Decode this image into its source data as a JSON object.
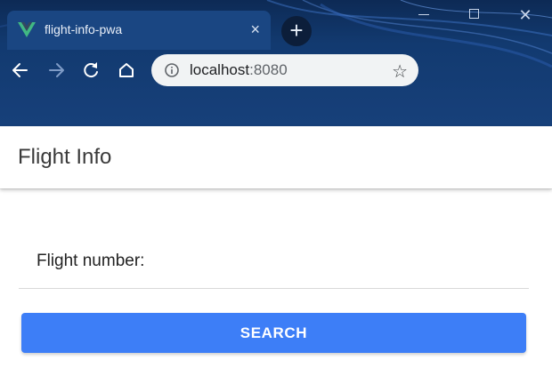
{
  "browser": {
    "tab": {
      "title": "flight-info-pwa",
      "favicon": "vue-logo-icon"
    },
    "address": {
      "host": "localhost",
      "port": ":8080"
    },
    "colors": {
      "chrome": "#17407a",
      "tab": "#1a4682"
    }
  },
  "app": {
    "title": "Flight Info",
    "form": {
      "flight_number_label": "Flight number:",
      "flight_number_value": ""
    },
    "search_button": "SEARCH",
    "colors": {
      "accent": "#3d7ef7"
    }
  }
}
